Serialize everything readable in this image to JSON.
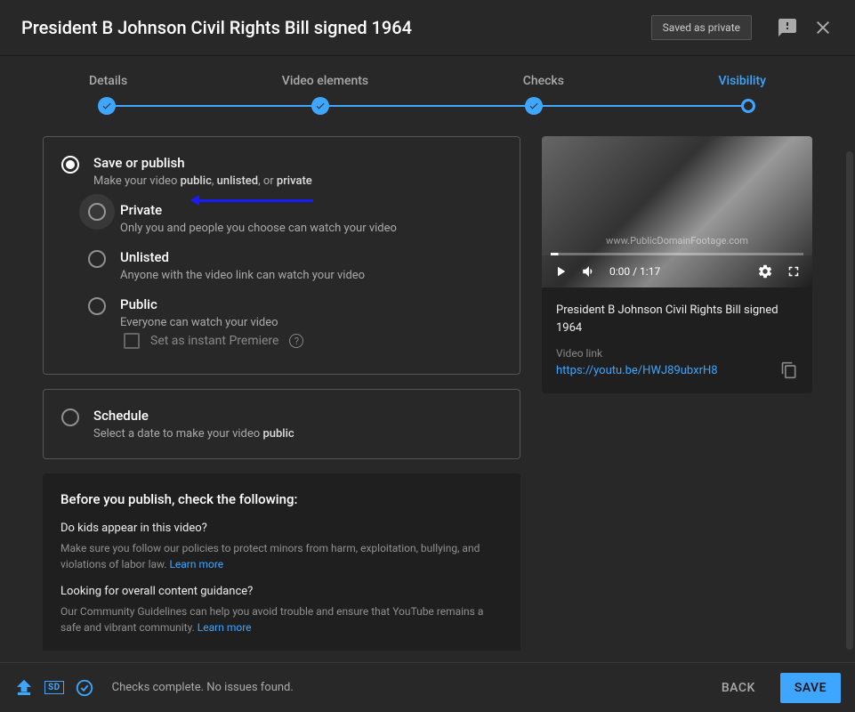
{
  "header": {
    "title": "President B Johnson Civil Rights Bill signed 1964",
    "badge": "Saved as private"
  },
  "stepper": {
    "s1": "Details",
    "s2": "Video elements",
    "s3": "Checks",
    "s4": "Visibility"
  },
  "publish": {
    "title": "Save or publish",
    "desc_pre": "Make your video ",
    "desc_b1": "public",
    "desc_sep": ", ",
    "desc_b2": "unlisted",
    "desc_sep2": ", or ",
    "desc_b3": "private",
    "private_title": "Private",
    "private_desc": "Only you and people you choose can watch your video",
    "unlisted_title": "Unlisted",
    "unlisted_desc": "Anyone with the video link can watch your video",
    "public_title": "Public",
    "public_desc": "Everyone can watch your video",
    "premiere": "Set as instant Premiere"
  },
  "schedule": {
    "title": "Schedule",
    "desc_pre": "Select a date to make your video ",
    "desc_b": "public"
  },
  "checks": {
    "heading": "Before you publish, check the following:",
    "q1": "Do kids appear in this video?",
    "d1": "Make sure you follow our policies to protect minors from harm, exploitation, bullying, and violations of labor law. ",
    "learn": "Learn more",
    "q2": "Looking for overall content guidance?",
    "d2": "Our Community Guidelines can help you avoid trouble and ensure that YouTube remains a safe and vibrant community. "
  },
  "preview": {
    "watermark": "www.PublicDomainFootage.com",
    "time": "0:00 / 1:17",
    "title": "President B Johnson Civil Rights Bill signed 1964",
    "link_label": "Video link",
    "link": "https://youtu.be/HWJ89ubxrH8"
  },
  "footer": {
    "sd": "SD",
    "status": "Checks complete. No issues found.",
    "back": "BACK",
    "save": "SAVE"
  }
}
